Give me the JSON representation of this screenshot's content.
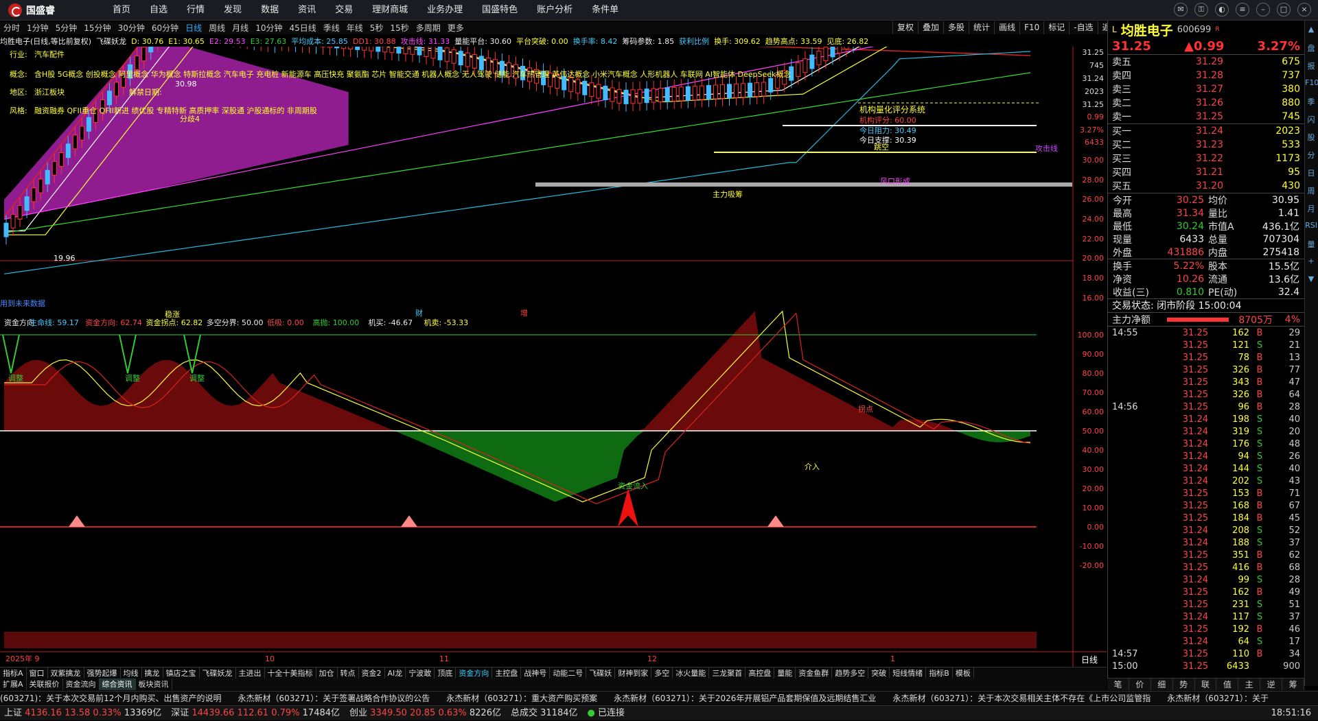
{
  "app": {
    "name": "国盛睿"
  },
  "menu": [
    "首页",
    "自选",
    "行情",
    "发现",
    "数据",
    "资讯",
    "交易",
    "理财商城",
    "业务办理",
    "国盛特色",
    "账户分析",
    "条件单"
  ],
  "periods": [
    "分时",
    "1分钟",
    "5分钟",
    "15分钟",
    "30分钟",
    "60分钟",
    "日线",
    "周线",
    "月线",
    "10分钟",
    "45日线",
    "季线",
    "年线",
    "5秒",
    "15秒",
    "多周期",
    "更多"
  ],
  "tools": [
    "复权",
    "叠加",
    "多股",
    "统计",
    "画线",
    "F10",
    "标记",
    "-自选",
    "返回"
  ],
  "info": [
    {
      "t": "均胜电子(日线,等比前复权)",
      "c": "wht"
    },
    {
      "t": "飞碟妖龙",
      "c": "wht"
    },
    {
      "t": "D: 30.76",
      "c": "yel"
    },
    {
      "t": "E1: 30.65",
      "c": "yel"
    },
    {
      "t": "E2: 29.53",
      "c": "mag"
    },
    {
      "t": "E3: 27.63",
      "c": "grn"
    },
    {
      "t": "平均成本: 25.85",
      "c": "cy"
    },
    {
      "t": "DD1: 30.88",
      "c": "red"
    },
    {
      "t": "攻击线: 31.33",
      "c": "mag"
    },
    {
      "t": "量能平台: 30.60",
      "c": "wht"
    },
    {
      "t": "平台突破: 0.00",
      "c": "yel"
    },
    {
      "t": "换手率: 8.42",
      "c": "cy"
    },
    {
      "t": "筹码参数: 1.85",
      "c": "wht"
    },
    {
      "t": "获利比例",
      "c": "cy"
    },
    {
      "t": "换手: 309.62",
      "c": "yel"
    },
    {
      "t": "趋势高点: 33.59",
      "c": "yel"
    },
    {
      "t": "见底: 26.82",
      "c": "yel"
    }
  ],
  "overlay": {
    "industry_k": "行业:",
    "industry_v": "汽车配件",
    "concept_k": "概念:",
    "concept_v": "含H股 5G概念 创投概念 阿里概念 华为概念 特斯拉概念 汽车电子 充电桩 新能源车 高压快充 聚氨酯 芯片 智能交通 机器人概念 无人驾驶 储能 汽车热管理 英伟达概念 小米汽车概念 人形机器人 车联网 AI智能体 DeepSeek概念",
    "region_k": "地区:",
    "region_v": "浙江板块",
    "style_k": "风格:",
    "style_v": "融资融券 QFII重仓 QFII新进 绩优股 专精特新 高质押率 深股通 沪股通标的 非周期股",
    "release": "解禁日期:",
    "jigou": "机构量化评分系统",
    "jigou_score": "机构评分: 60.00",
    "resist": "今日阻力: 30.49",
    "support": "今日支撑: 30.39",
    "attack": "攻击线",
    "fengkou": "风口形成",
    "zhuli": "主力吸筹",
    "fenqi": "分歧4",
    "tiao": "跳空",
    "hi": "30.98",
    "lo": "19.96",
    "bottom_note": "用到未来数据",
    "wen": "稳涨",
    "cai": "财",
    "zeng": "增"
  },
  "axis_main": [
    "31.25",
    "745",
    "31.24",
    "2023",
    "31.25",
    "0.99",
    "3.27%",
    "6433",
    "30.00",
    "28.00",
    "26.00",
    "24.00",
    "22.00",
    "20.00",
    "18.00",
    "16.00"
  ],
  "axis_sub": [
    "100.00",
    "90.00",
    "80.00",
    "70.00",
    "60.00",
    "50.00",
    "40.00",
    "30.00",
    "20.00",
    "10.00",
    "0.00",
    "-10.00",
    "-20.00"
  ],
  "dates": [
    "2025年 9",
    "10",
    "11",
    "12",
    "1"
  ],
  "sub_info": [
    {
      "t": "资金方向",
      "c": "wht"
    },
    {
      "t": "生命线: 59.17",
      "c": "cy"
    },
    {
      "t": "资金方向: 62.74",
      "c": "red"
    },
    {
      "t": "资金拐点: 62.82",
      "c": "yel"
    },
    {
      "t": "多空分界: 50.00",
      "c": "wht"
    },
    {
      "t": "低吸: 0.00",
      "c": "red"
    },
    {
      "t": "高抛: 100.00",
      "c": "grn"
    },
    {
      "t": "机买: -46.67",
      "c": "wht"
    },
    {
      "t": "机卖: -53.33",
      "c": "yel"
    }
  ],
  "sub_labels": {
    "t1": "调整",
    "t2": "调整",
    "t3": "调整",
    "in": "资金流入",
    "buy": "介入",
    "cut": "拐点"
  },
  "ind_tabs": [
    "指标A",
    "窗口",
    "双紫擒龙",
    "强势起爆",
    "均线",
    "擒龙",
    "镇店之宝",
    "飞碟妖龙",
    "主进出",
    "十全十美指标",
    "加仓",
    "转点",
    "资金2",
    "AI龙",
    "宁波敢",
    "顶底",
    "资金方向",
    "主控盘",
    "战神号",
    "动能二号",
    "飞碟妖",
    "财神到家",
    "多空",
    "冰火量能",
    "三龙聚首",
    "高控盘",
    "量能",
    "资金鱼群",
    "趋势多空",
    "突破",
    "短线情绪",
    "指标B",
    "模板"
  ],
  "bot_tabs": [
    "扩展A",
    "关联报价",
    "资金流向",
    "综合资讯",
    "板块资讯"
  ],
  "period_label": "日线",
  "stock": {
    "name": "均胜电子",
    "code": "600699",
    "sup": "R",
    "price": "31.25",
    "change": "▲0.99",
    "pct": "3.27%"
  },
  "asks": [
    [
      "卖五",
      "31.29",
      "675"
    ],
    [
      "卖四",
      "31.28",
      "737"
    ],
    [
      "卖三",
      "31.27",
      "380"
    ],
    [
      "卖二",
      "31.26",
      "880"
    ],
    [
      "卖一",
      "31.25",
      "745"
    ]
  ],
  "bids": [
    [
      "买一",
      "31.24",
      "2023"
    ],
    [
      "买二",
      "31.23",
      "533"
    ],
    [
      "买三",
      "31.22",
      "1173"
    ],
    [
      "买四",
      "31.21",
      "95"
    ],
    [
      "买五",
      "31.20",
      "430"
    ]
  ],
  "stats1": [
    [
      "今开",
      "30.25",
      "均价",
      "30.95"
    ],
    [
      "最高",
      "31.34",
      "量比",
      "1.41"
    ],
    [
      "最低",
      "30.24",
      "市值A",
      "436.1亿"
    ],
    [
      "现量",
      "6433",
      "总量",
      "707304"
    ],
    [
      "外盘",
      "431886",
      "内盘",
      "275418"
    ]
  ],
  "stats2": [
    [
      "换手",
      "5.22%",
      "股本",
      "15.5亿"
    ],
    [
      "净资",
      "10.26",
      "流通",
      "13.6亿"
    ],
    [
      "收益(三)",
      "0.810",
      "PE(动)",
      "32.4"
    ]
  ],
  "trade_status": "交易状态: 闭市阶段 15:00:04",
  "netflow": {
    "label": "主力净额",
    "value": "8705万",
    "pct": "4%"
  },
  "trades": [
    [
      "14:55",
      "31.25",
      "162",
      "B",
      "29"
    ],
    [
      "",
      "31.25",
      "121",
      "S",
      "21"
    ],
    [
      "",
      "31.25",
      "78",
      "B",
      "13"
    ],
    [
      "",
      "31.25",
      "326",
      "B",
      "77"
    ],
    [
      "",
      "31.25",
      "343",
      "B",
      "47"
    ],
    [
      "",
      "31.25",
      "326",
      "B",
      "64"
    ],
    [
      "14:56",
      "31.25",
      "96",
      "B",
      "28"
    ],
    [
      "",
      "31.24",
      "198",
      "S",
      "40"
    ],
    [
      "",
      "31.24",
      "319",
      "S",
      "20"
    ],
    [
      "",
      "31.24",
      "176",
      "S",
      "48"
    ],
    [
      "",
      "31.24",
      "94",
      "S",
      "26"
    ],
    [
      "",
      "31.24",
      "144",
      "S",
      "40"
    ],
    [
      "",
      "31.24",
      "202",
      "S",
      "43"
    ],
    [
      "",
      "31.25",
      "153",
      "B",
      "71"
    ],
    [
      "",
      "31.25",
      "168",
      "B",
      "67"
    ],
    [
      "",
      "31.25",
      "184",
      "B",
      "45"
    ],
    [
      "",
      "31.24",
      "208",
      "S",
      "52"
    ],
    [
      "",
      "31.24",
      "188",
      "S",
      "37"
    ],
    [
      "",
      "31.25",
      "351",
      "B",
      "62"
    ],
    [
      "",
      "31.25",
      "416",
      "B",
      "68"
    ],
    [
      "",
      "31.24",
      "99",
      "S",
      "28"
    ],
    [
      "",
      "31.25",
      "162",
      "B",
      "49"
    ],
    [
      "",
      "31.25",
      "231",
      "S",
      "51"
    ],
    [
      "",
      "31.24",
      "117",
      "S",
      "37"
    ],
    [
      "",
      "31.25",
      "192",
      "B",
      "46"
    ],
    [
      "",
      "31.24",
      "64",
      "S",
      "17"
    ],
    [
      "14:57",
      "31.25",
      "110",
      "B",
      "34"
    ],
    [
      "15:00",
      "31.25",
      "6433",
      "",
      "900"
    ]
  ],
  "quote_tabs": [
    "笔",
    "价",
    "细",
    "势",
    "联",
    "值",
    "主",
    "逆",
    "筹"
  ],
  "side_icons": [
    "▲",
    "盘",
    "报",
    "F10",
    "季",
    "闪",
    "股",
    "分",
    "日",
    "周",
    "月",
    "RSI",
    "量",
    "+",
    "▼"
  ],
  "news": [
    "(603271)：关于本次交易前12个月内购买、出售资产的说明",
    "永杰新材（603271）：关于签署战略合作协议的公告",
    "永杰新材（603271）：重大资产购买预案",
    "永杰新材（603271）：关于2026年开展铝产品套期保值及远期结售汇业",
    "永杰新材（603271）：关于本次交易相关主体不存在《上市公司监管指",
    "永杰新材（603271）：关于"
  ],
  "status": {
    "sh": "上证",
    "sh_v": "4136.16",
    "sh_c": "13.58",
    "sh_p": "0.33%",
    "sh_a": "13369亿",
    "sz": "深证",
    "sz_v": "14439.66",
    "sz_c": "112.61",
    "sz_p": "0.79%",
    "sz_a": "17484亿",
    "cy": "创业",
    "cy_v": "3349.50",
    "cy_c": "20.85",
    "cy_p": "0.63%",
    "cy_a": "8226亿",
    "tot_k": "总成交",
    "tot": "31184亿",
    "conn": "已连接",
    "time": "18:51:16"
  }
}
